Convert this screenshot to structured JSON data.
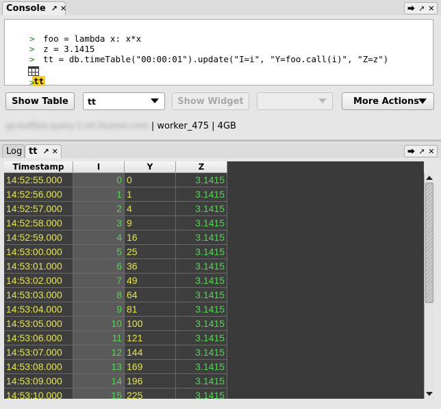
{
  "console_panel": {
    "tab_label": "Console",
    "lines": [
      {
        "prompt": ">",
        "code": "foo = lambda x: x*x"
      },
      {
        "prompt": ">",
        "code": "z = 3.1415"
      },
      {
        "prompt": ">",
        "code": "tt = db.timeTable(\"00:00:01\").update(\"I=i\", \"Y=foo.call(i)\", \"Z=z\")"
      }
    ],
    "result_label": "tt",
    "empty_prompt": ">",
    "show_table_label": "Show Table",
    "table_select_value": "tt",
    "show_widget_label": "Show Widget",
    "more_actions_label": "More Actions",
    "host_blurred": "qa-buffalo-query-1.int.illumon.com",
    "worker_info": " | worker_475 | 4GB"
  },
  "table_panel": {
    "tabs": [
      {
        "label": "Log"
      },
      {
        "label": "tt"
      }
    ],
    "columns": [
      "Timestamp",
      "I",
      "Y",
      "Z"
    ],
    "rows": [
      [
        "14:52:55.000",
        "0",
        "0",
        "3.1415"
      ],
      [
        "14:52:56.000",
        "1",
        "1",
        "3.1415"
      ],
      [
        "14:52:57.000",
        "2",
        "4",
        "3.1415"
      ],
      [
        "14:52:58.000",
        "3",
        "9",
        "3.1415"
      ],
      [
        "14:52:59.000",
        "4",
        "16",
        "3.1415"
      ],
      [
        "14:53:00.000",
        "5",
        "25",
        "3.1415"
      ],
      [
        "14:53:01.000",
        "6",
        "36",
        "3.1415"
      ],
      [
        "14:53:02.000",
        "7",
        "49",
        "3.1415"
      ],
      [
        "14:53:03.000",
        "8",
        "64",
        "3.1415"
      ],
      [
        "14:53:04.000",
        "9",
        "81",
        "3.1415"
      ],
      [
        "14:53:05.000",
        "10",
        "100",
        "3.1415"
      ],
      [
        "14:53:06.000",
        "11",
        "121",
        "3.1415"
      ],
      [
        "14:53:07.000",
        "12",
        "144",
        "3.1415"
      ],
      [
        "14:53:08.000",
        "13",
        "169",
        "3.1415"
      ],
      [
        "14:53:09.000",
        "14",
        "196",
        "3.1415"
      ],
      [
        "14:53:10.000",
        "15",
        "225",
        "3.1415"
      ]
    ]
  },
  "colors": {
    "text_yellow": "#e6e64b",
    "text_green": "#55d455",
    "grid_bg": "#3a3a3a",
    "highlight_yellow": "#ffd200"
  },
  "icons": [
    "pin-icon",
    "close-icon",
    "share-icon",
    "popout-icon",
    "table-icon",
    "dropdown-arrow-icon",
    "scroll-up-icon",
    "scroll-down-icon"
  ]
}
